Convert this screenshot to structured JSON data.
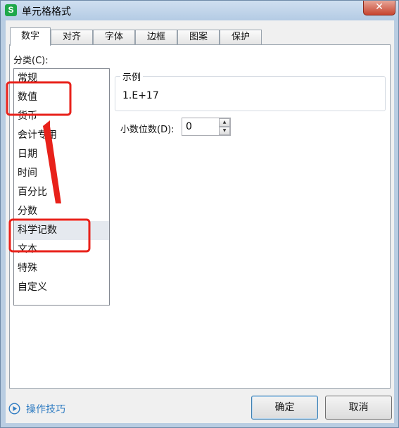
{
  "window": {
    "title": "单元格格式",
    "app_icon": "S",
    "close": "✕"
  },
  "tabs": [
    {
      "label": "数字",
      "active": true
    },
    {
      "label": "对齐"
    },
    {
      "label": "字体"
    },
    {
      "label": "边框"
    },
    {
      "label": "图案"
    },
    {
      "label": "保护"
    }
  ],
  "category": {
    "label": "分类(C):",
    "items": [
      "常规",
      "数值",
      "货币",
      "会计专用",
      "日期",
      "时间",
      "百分比",
      "分数",
      "科学记数",
      "文本",
      "特殊",
      "自定义"
    ],
    "selected": "科学记数"
  },
  "sample": {
    "legend": "示例",
    "value": "1.E+17"
  },
  "decimal": {
    "label": "小数位数(D):",
    "value": "0",
    "up": "▲",
    "down": "▼"
  },
  "footer": {
    "tips": "操作技巧",
    "ok": "确定",
    "cancel": "取消"
  },
  "colors": {
    "annotation": "#e8211a",
    "link": "#2f7cc2"
  }
}
